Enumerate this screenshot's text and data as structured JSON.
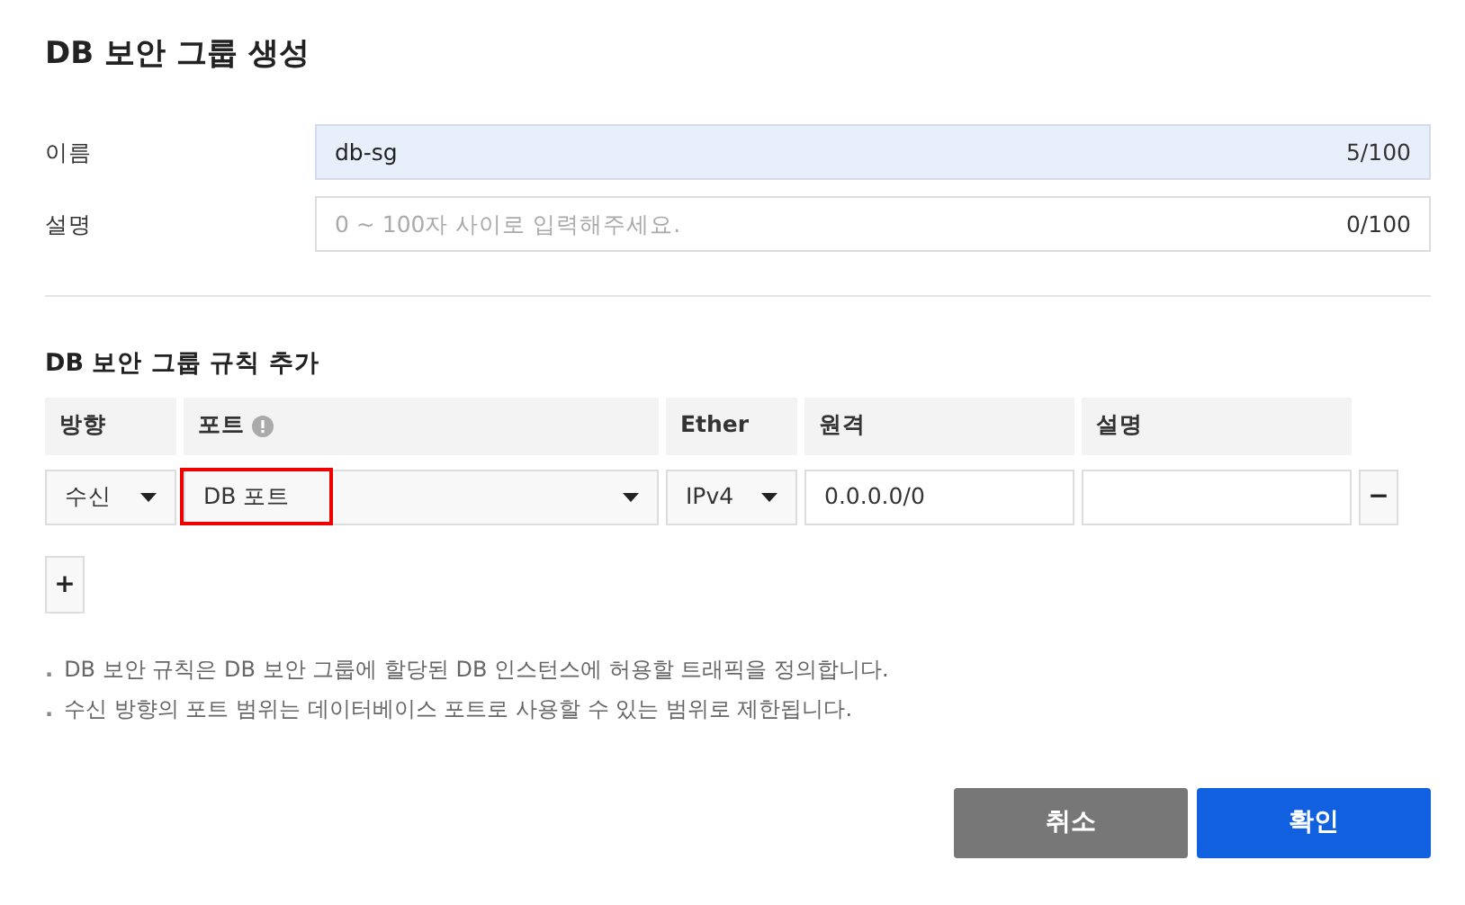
{
  "title": "DB 보안 그룹 생성",
  "fields": [
    {
      "label": "이름",
      "value": "db-sg",
      "counter": "5/100",
      "filled": true
    },
    {
      "label": "설명",
      "placeholder": "0 ~ 100자 사이로 입력해주세요.",
      "counter": "0/100",
      "filled": false
    }
  ],
  "rules": {
    "title": "DB 보안 그룹 규칙 추가",
    "columns": [
      {
        "label": "방향",
        "info": false
      },
      {
        "label": "포트",
        "info": true
      },
      {
        "label": "Ether",
        "info": false
      },
      {
        "label": "원격",
        "info": false
      },
      {
        "label": "설명",
        "info": false
      }
    ],
    "rows": [
      {
        "direction": "수신",
        "port": "DB 포트",
        "port_highlighted": true,
        "ether": "IPv4",
        "remote": "0.0.0.0/0",
        "remove": "−"
      }
    ],
    "add": "+"
  },
  "notes": [
    {
      "marker": ".",
      "text": "DB 보안 규칙은 DB 보안 그룹에 할당된 DB 인스턴스에 허용할 트래픽을 정의합니다."
    },
    {
      "marker": ".",
      "text": "수신 방향의 포트 범위는 데이터베이스 포트로 사용할 수 있는 범위로 제한됩니다."
    }
  ],
  "buttons": [
    {
      "label": "취소",
      "kind": "secondary"
    },
    {
      "label": "확인",
      "kind": "primary"
    }
  ]
}
